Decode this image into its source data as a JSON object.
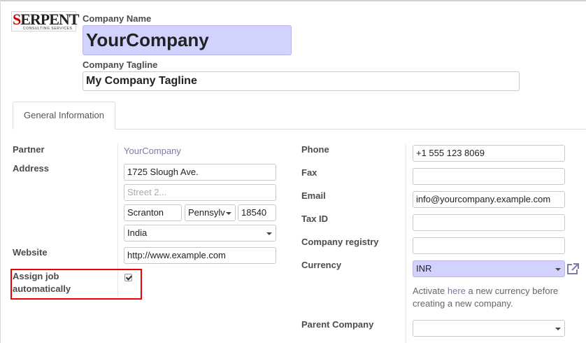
{
  "logo": {
    "main_first": "S",
    "main_rest": "ERPENT",
    "sub": "CONSULTING SERVICES"
  },
  "header": {
    "company_name_label": "Company Name",
    "company_name_value": "YourCompany",
    "tagline_label": "Company Tagline",
    "tagline_value": "My Company Tagline"
  },
  "tabs": [
    {
      "label": "General Information",
      "active": true
    }
  ],
  "left": {
    "partner_label": "Partner",
    "partner_value": "YourCompany",
    "address_label": "Address",
    "street": "1725 Slough Ave.",
    "street2_placeholder": "Street 2...",
    "city": "Scranton",
    "state": "Pennsylv",
    "zip": "18540",
    "country": "India",
    "website_label": "Website",
    "website_value": "http://www.example.com",
    "assign_job_label_line1": "Assign job",
    "assign_job_label_line2": "automatically",
    "assign_job_checked": true
  },
  "right": {
    "phone_label": "Phone",
    "phone_value": "+1 555 123 8069",
    "fax_label": "Fax",
    "fax_value": "",
    "email_label": "Email",
    "email_value": "info@yourcompany.example.com",
    "taxid_label": "Tax ID",
    "taxid_value": "",
    "registry_label": "Company registry",
    "registry_value": "",
    "currency_label": "Currency",
    "currency_value": "INR",
    "help_before": "Activate ",
    "help_link": "here",
    "help_after": " a new currency before creating a new company.",
    "parent_label": "Parent Company",
    "parent_value": ""
  },
  "colors": {
    "required_bg": "#d2d2ff",
    "link": "#7c7bad",
    "highlight": "#ee0000"
  }
}
